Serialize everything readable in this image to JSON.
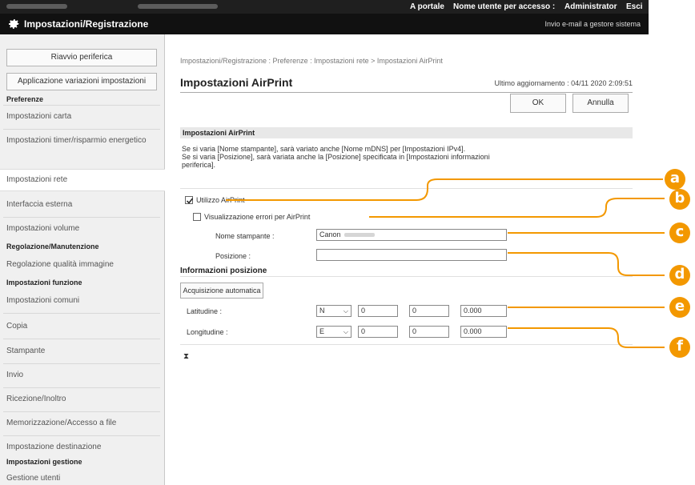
{
  "topbar": {
    "portal": "A portale",
    "user_label": "Nome utente per accesso :",
    "user": "Administrator",
    "logout": "Esci"
  },
  "titlebar": {
    "icon": "gear-icon",
    "title": "Impostazioni/Registrazione",
    "mail_link": "Invio e-mail a gestore sistema"
  },
  "sidebar": {
    "restart": "Riavvio periferica",
    "apply": "Applicazione variazioni impostazioni",
    "sections": [
      {
        "head": "Preferenze"
      },
      {
        "head": "Regolazione/Manutenzione"
      },
      {
        "head": "Impostazioni funzione"
      },
      {
        "head": "Impostazioni gestione"
      }
    ],
    "items": {
      "carta": "Impostazioni carta",
      "timer": "Impostazioni timer/risparmio energetico",
      "rete": "Impostazioni rete",
      "interfaccia": "Interfaccia esterna",
      "volume": "Impostazioni volume",
      "qualita": "Regolazione qualità immagine",
      "comuni": "Impostazioni comuni",
      "copia": "Copia",
      "stampante": "Stampante",
      "invio": "Invio",
      "ricezione": "Ricezione/Inoltro",
      "memorizzazione": "Memorizzazione/Accesso a file",
      "destinazione": "Impostazione destinazione",
      "utenti": "Gestione utenti"
    }
  },
  "main": {
    "breadcrumb": "Impostazioni/Registrazione : Preferenze : Impostazioni rete > Impostazioni AirPrint",
    "title": "Impostazioni AirPrint",
    "last_update": "Ultimo aggiornamento : 04/11 2020 2:09:51",
    "ok": "OK",
    "cancel": "Annulla",
    "section": "Impostazioni AirPrint",
    "desc1": "Se si varia [Nome stampante], sarà variato anche [Nome mDNS] per [Impostazioni IPv4].",
    "desc2": "Se si varia [Posizione], sarà variata anche la [Posizione] specificata in [Impostazioni informazioni periferica].",
    "use_airprint": "Utilizzo AirPrint",
    "use_airprint_checked": true,
    "error_display": "Visualizzazione errori per AirPrint",
    "error_display_checked": false,
    "printer_name_label": "Nome stampante :",
    "printer_name_value": "Canon",
    "location_label": "Posizione :",
    "location_value": "",
    "pos_info": "Informazioni posizione",
    "auto_acquire": "Acquisizione automatica",
    "latitude_label": "Latitudine :",
    "lat_dir": "N",
    "lat_deg": "0",
    "lat_min": "0",
    "lat_sec": "0.000",
    "longitude_label": "Longitudine :",
    "lon_dir": "E",
    "lon_deg": "0",
    "lon_min": "0",
    "lon_sec": "0.000",
    "end_mark": "⧗"
  },
  "callouts": [
    "a",
    "b",
    "c",
    "d",
    "e",
    "f"
  ],
  "colors": {
    "callout": "#f39800",
    "header": "#111111"
  }
}
